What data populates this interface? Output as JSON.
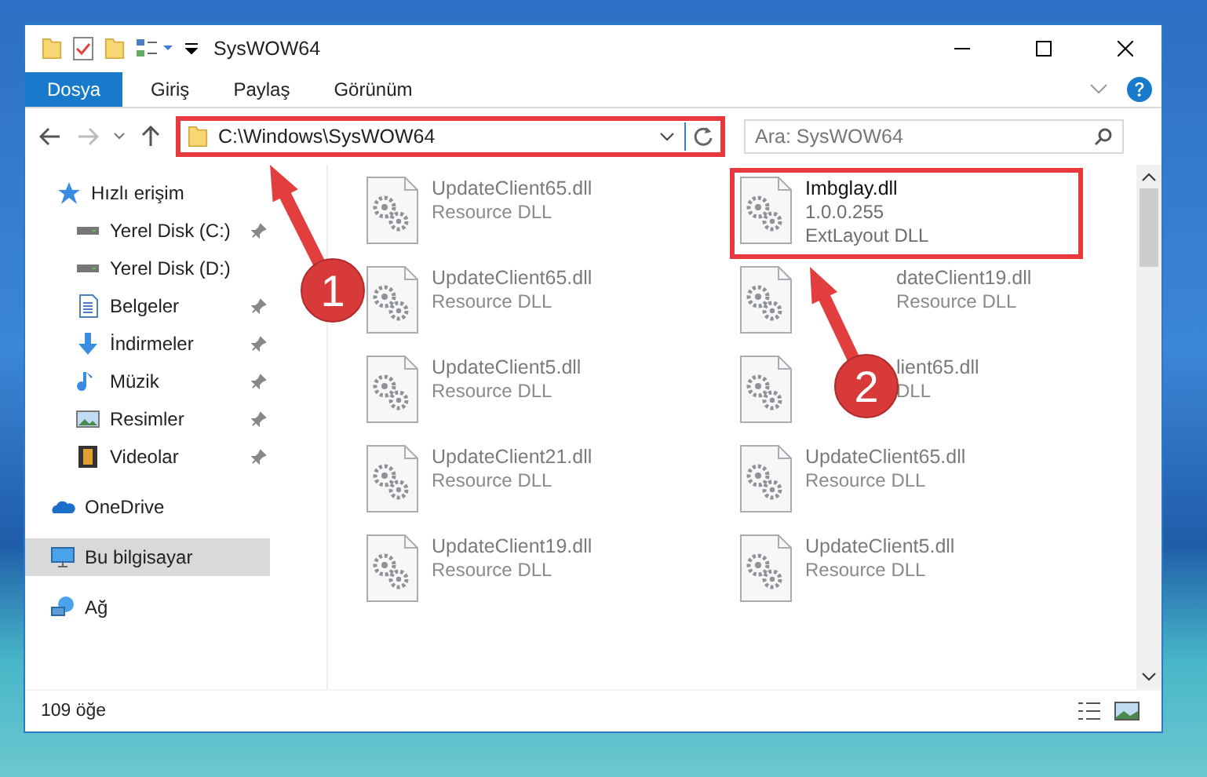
{
  "window": {
    "title": "SysWOW64"
  },
  "ribbon_tabs": [
    {
      "label": "Dosya",
      "selected": true
    },
    {
      "label": "Giriş",
      "selected": false
    },
    {
      "label": "Paylaş",
      "selected": false
    },
    {
      "label": "Görünüm",
      "selected": false
    }
  ],
  "address": {
    "value": "C:\\Windows\\SysWOW64",
    "highlighted": true
  },
  "search": {
    "placeholder": "Ara: SysWOW64"
  },
  "sidebar": {
    "items": [
      {
        "label": "Hızlı erişim",
        "kind": "star",
        "selected": false,
        "pinned": false,
        "children": [
          {
            "label": "Yerel Disk (C:)",
            "kind": "drive",
            "selected": false,
            "pinned": true
          },
          {
            "label": "Yerel Disk (D:)",
            "kind": "drive",
            "selected": false,
            "pinned": false
          },
          {
            "label": "Belgeler",
            "kind": "documents",
            "selected": false,
            "pinned": true
          },
          {
            "label": "İndirmeler",
            "kind": "download",
            "selected": false,
            "pinned": true
          },
          {
            "label": "Müzik",
            "kind": "music",
            "selected": false,
            "pinned": true
          },
          {
            "label": "Resimler",
            "kind": "pictures",
            "selected": false,
            "pinned": true
          },
          {
            "label": "Videolar",
            "kind": "video",
            "selected": false,
            "pinned": true
          }
        ]
      },
      {
        "label": "OneDrive",
        "kind": "cloud",
        "selected": false,
        "pinned": false
      },
      {
        "label": "Bu bilgisayar",
        "kind": "computer",
        "selected": true,
        "pinned": false
      },
      {
        "label": "Ağ",
        "kind": "network",
        "selected": false,
        "pinned": false
      }
    ]
  },
  "files": [
    {
      "name": "UpdateClient65.dll",
      "details": [
        "Resource DLL"
      ],
      "blurred": true,
      "highlighted": false,
      "partly_hidden": false
    },
    {
      "name": "Imbglay.dll",
      "details": [
        "1.0.0.255",
        "ExtLayout DLL"
      ],
      "blurred": false,
      "highlighted": true,
      "partly_hidden": false
    },
    {
      "name": "UpdateClient65.dll",
      "details": [
        "Resource DLL"
      ],
      "blurred": true,
      "highlighted": false,
      "partly_hidden": false
    },
    {
      "name": "dateClient19.dll",
      "details": [
        "Resource DLL"
      ],
      "blurred": true,
      "highlighted": false,
      "partly_hidden": true
    },
    {
      "name": "UpdateClient5.dll",
      "details": [
        "Resource DLL"
      ],
      "blurred": true,
      "highlighted": false,
      "partly_hidden": false
    },
    {
      "name": "lient65.dll",
      "details": [
        "DLL"
      ],
      "blurred": true,
      "highlighted": false,
      "partly_hidden": true
    },
    {
      "name": "UpdateClient21.dll",
      "details": [
        "Resource DLL"
      ],
      "blurred": true,
      "highlighted": false,
      "partly_hidden": false
    },
    {
      "name": "UpdateClient65.dll",
      "details": [
        "Resource DLL"
      ],
      "blurred": true,
      "highlighted": false,
      "partly_hidden": false
    },
    {
      "name": "UpdateClient19.dll",
      "details": [
        "Resource DLL"
      ],
      "blurred": true,
      "highlighted": false,
      "partly_hidden": false
    },
    {
      "name": "UpdateClient5.dll",
      "details": [
        "Resource DLL"
      ],
      "blurred": true,
      "highlighted": false,
      "partly_hidden": false
    }
  ],
  "status_bar": {
    "count": "109 öğe"
  },
  "annotations": [
    {
      "label": "1"
    },
    {
      "label": "2"
    }
  ]
}
